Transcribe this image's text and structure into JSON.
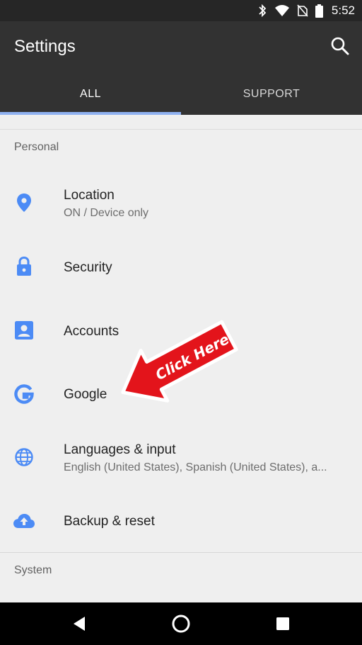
{
  "status_bar": {
    "time": "5:52"
  },
  "app_bar": {
    "title": "Settings",
    "tabs": [
      {
        "label": "ALL"
      },
      {
        "label": "SUPPORT"
      }
    ]
  },
  "sections": {
    "personal": "Personal",
    "system": "System"
  },
  "items": [
    {
      "title": "Location",
      "subtitle": "ON / Device only",
      "icon": "location-icon"
    },
    {
      "title": "Security",
      "icon": "lock-icon"
    },
    {
      "title": "Accounts",
      "icon": "account-icon"
    },
    {
      "title": "Google",
      "icon": "google-icon"
    },
    {
      "title": "Languages & input",
      "subtitle": "English (United States), Spanish (United States), a...",
      "icon": "globe-icon"
    },
    {
      "title": "Backup & reset",
      "icon": "cloud-upload-icon"
    }
  ],
  "callout": {
    "text": "Click Here",
    "color": "#e3141b"
  },
  "colors": {
    "accent": "#5b8fe8",
    "tab_indicator": "#8fb1f0",
    "icon_blue": "#4c8bf5"
  }
}
